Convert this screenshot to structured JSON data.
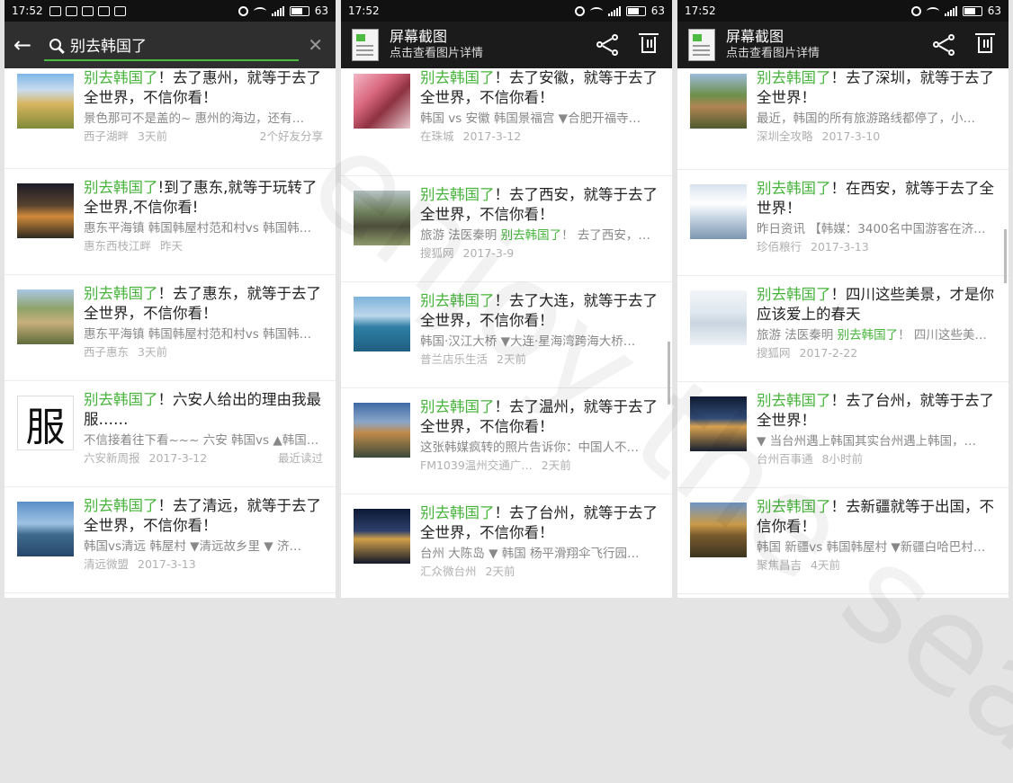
{
  "status": {
    "time": "17:52",
    "battery": "63"
  },
  "search": {
    "query": "别去韩国了"
  },
  "screenshot_header": {
    "title": "屏幕截图",
    "subtitle": "点击查看图片详情"
  },
  "watermark": "enjoy the sea",
  "panel1": [
    {
      "hl": "别去韩国了",
      "rest": "！去了惠州，就等于去了全世界，不信你看！",
      "desc": "景色那可不是盖的~ 惠州的海边，还有…",
      "source": "西子湖畔",
      "date": "3天前",
      "extra": "2个好友分享",
      "img": "linear-gradient(180deg,#7fb6e6 0%,#c9dcee 30%,#d8b55f 55%,#7f8a38 100%)"
    },
    {
      "hl": "别去韩国了",
      "rest": "!到了惠东,就等于玩转了全世界,不信你看!",
      "desc": "惠东平海镇 韩国韩屋村范和村vs 韩国韩…",
      "source": "惠东西枝江畔",
      "date": "昨天",
      "extra": "",
      "img": "linear-gradient(180deg,#1d1b26 0%,#57422f 40%,#d08a3a 60%,#2e2a22 100%)"
    },
    {
      "hl": "别去韩国了",
      "rest": "！去了惠东，就等于去了全世界，不信你看！",
      "desc": "惠东平海镇 韩国韩屋村范和村vs 韩国韩…",
      "source": "西子惠东",
      "date": "3天前",
      "extra": "",
      "img": "linear-gradient(180deg,#a9c7e3 0%,#8fa36a 35%,#c7b07b 60%,#5f6b3c 100%)"
    },
    {
      "hl": "别去韩国了",
      "rest": "！六安人给出的理由我最服……",
      "desc": "不信接着往下看~~~ 六安 韩国vs ▲韩国…",
      "source": "六安新周报",
      "date": "2017-3-12",
      "extra": "最近读过",
      "img": "char"
    },
    {
      "hl": "别去韩国了",
      "rest": "！去了清远，就等于去了全世界，不信你看！",
      "desc": "韩国vs清远 韩屋村 ▼清远故乡里 ▼ 济…",
      "source": "清远微盟",
      "date": "2017-3-13",
      "extra": "",
      "img": "linear-gradient(180deg,#5b8fc9 0%,#9ec3e3 40%,#3e6a8e 60%,#27476a 100%)"
    }
  ],
  "panel1_char": "服",
  "panel2": [
    {
      "hl": "别去韩国了",
      "rest": "！去了安徽，就等于去了全世界，不信你看！",
      "desc": "韩国 vs 安徽 韩国景福宫 ▼合肥开福寺…",
      "source": "在珠城",
      "date": "2017-3-12",
      "extra": "",
      "img": "linear-gradient(135deg,#f3b7c6 0%,#d9677e 35%,#8e3140 60%,#e9c9cf 100%)"
    },
    {
      "hl": "别去韩国了",
      "rest": "！去了西安，就等于去了全世界，不信你看！",
      "desc_pre": "旅游 法医秦明 ",
      "desc_hl": "别去韩国了",
      "desc": "！ 去了西安，…",
      "source": "搜狐网",
      "date": "2017-3-9",
      "extra": "",
      "img": "linear-gradient(180deg,#b7c4c6 0%,#6d7f5a 40%,#4e4e3c 65%,#8d9a6a 100%)"
    },
    {
      "hl": "别去韩国了",
      "rest": "！去了大连，就等于去了全世界，不信你看！",
      "desc": "韩国·汉江大桥 ▼大连·星海湾跨海大桥…",
      "source": "普兰店乐生活",
      "date": "2天前",
      "extra": "",
      "img": "linear-gradient(180deg,#7fb3dc 0%,#bcd7ea 35%,#2f7fa6 55%,#1f5f80 100%)"
    },
    {
      "hl": "别去韩国了",
      "rest": "！去了温州，就等于去了全世界，不信你看！",
      "desc": "这张韩媒疯转的照片告诉你：中国人不…",
      "source": "FM1039温州交通广…",
      "date": "2天前",
      "extra": "",
      "img": "linear-gradient(180deg,#3e6aa5 0%,#8ba6c9 35%,#c08a4a 55%,#3b4a3a 100%)"
    },
    {
      "hl": "别去韩国了",
      "rest": "！去了台州，就等于去了全世界，不信你看！",
      "desc": "台州 大陈岛 ▼ 韩国 杨平滑翔伞飞行园…",
      "source": "汇众微台州",
      "date": "2天前",
      "extra": "",
      "img": "linear-gradient(180deg,#0d1a35 0%,#2d3f6b 40%,#d0a04a 55%,#12182a 100%)"
    }
  ],
  "panel3": [
    {
      "hl": "别去韩国了",
      "rest": "！去了深圳，就等于去了全世界！",
      "desc": "最近，韩国的所有旅游路线都停了，小…",
      "source": "深圳全攻略",
      "date": "2017-3-10",
      "extra": "",
      "img": "linear-gradient(180deg,#9bbbd8 0%,#6e8f4a 40%,#b28453 60%,#4d5b2f 100%)"
    },
    {
      "hl": "别去韩国了",
      "rest": "！在西安，就等于去了全世界！",
      "desc": "昨日资讯 【韩媒：3400名中国游客在济…",
      "source": "珍佰粮行",
      "date": "2017-3-13",
      "extra": "",
      "img": "linear-gradient(180deg,#d8e3ee 0%,#ffffff 35%,#c8d6e4 60%,#7d96b0 100%)"
    },
    {
      "hl": "别去韩国了",
      "rest": "！四川这些美景，才是你应该爱上的春天",
      "desc_pre": "旅游 法医秦明 ",
      "desc_hl": "别去韩国了",
      "desc": "！ 四川这些美…",
      "source": "搜狐网",
      "date": "2017-2-22",
      "extra": "",
      "img": "linear-gradient(180deg,#f2f5f8 0%,#dfe7ef 40%,#c9d5e0 60%,#eef2f6 100%)"
    },
    {
      "hl": "别去韩国了",
      "rest": "！去了台州，就等于去了全世界！",
      "desc": "▼ 当台州遇上韩国其实台州遇上韩国，…",
      "source": "台州百事通",
      "date": "8小时前",
      "extra": "",
      "img": "linear-gradient(180deg,#101b33 0%,#324d78 40%,#d9a24f 55%,#182030 100%)"
    },
    {
      "hl": "别去韩国了",
      "rest": "！去新疆就等于出国，不信你看！",
      "desc": "韩国 新疆vs 韩国韩屋村 ▼新疆白哈巴村…",
      "source": "聚焦昌吉",
      "date": "4天前",
      "extra": "",
      "img": "linear-gradient(180deg,#6f95c6 0%,#c99a48 40%,#7a5a2e 60%,#3b3520 100%)"
    }
  ]
}
